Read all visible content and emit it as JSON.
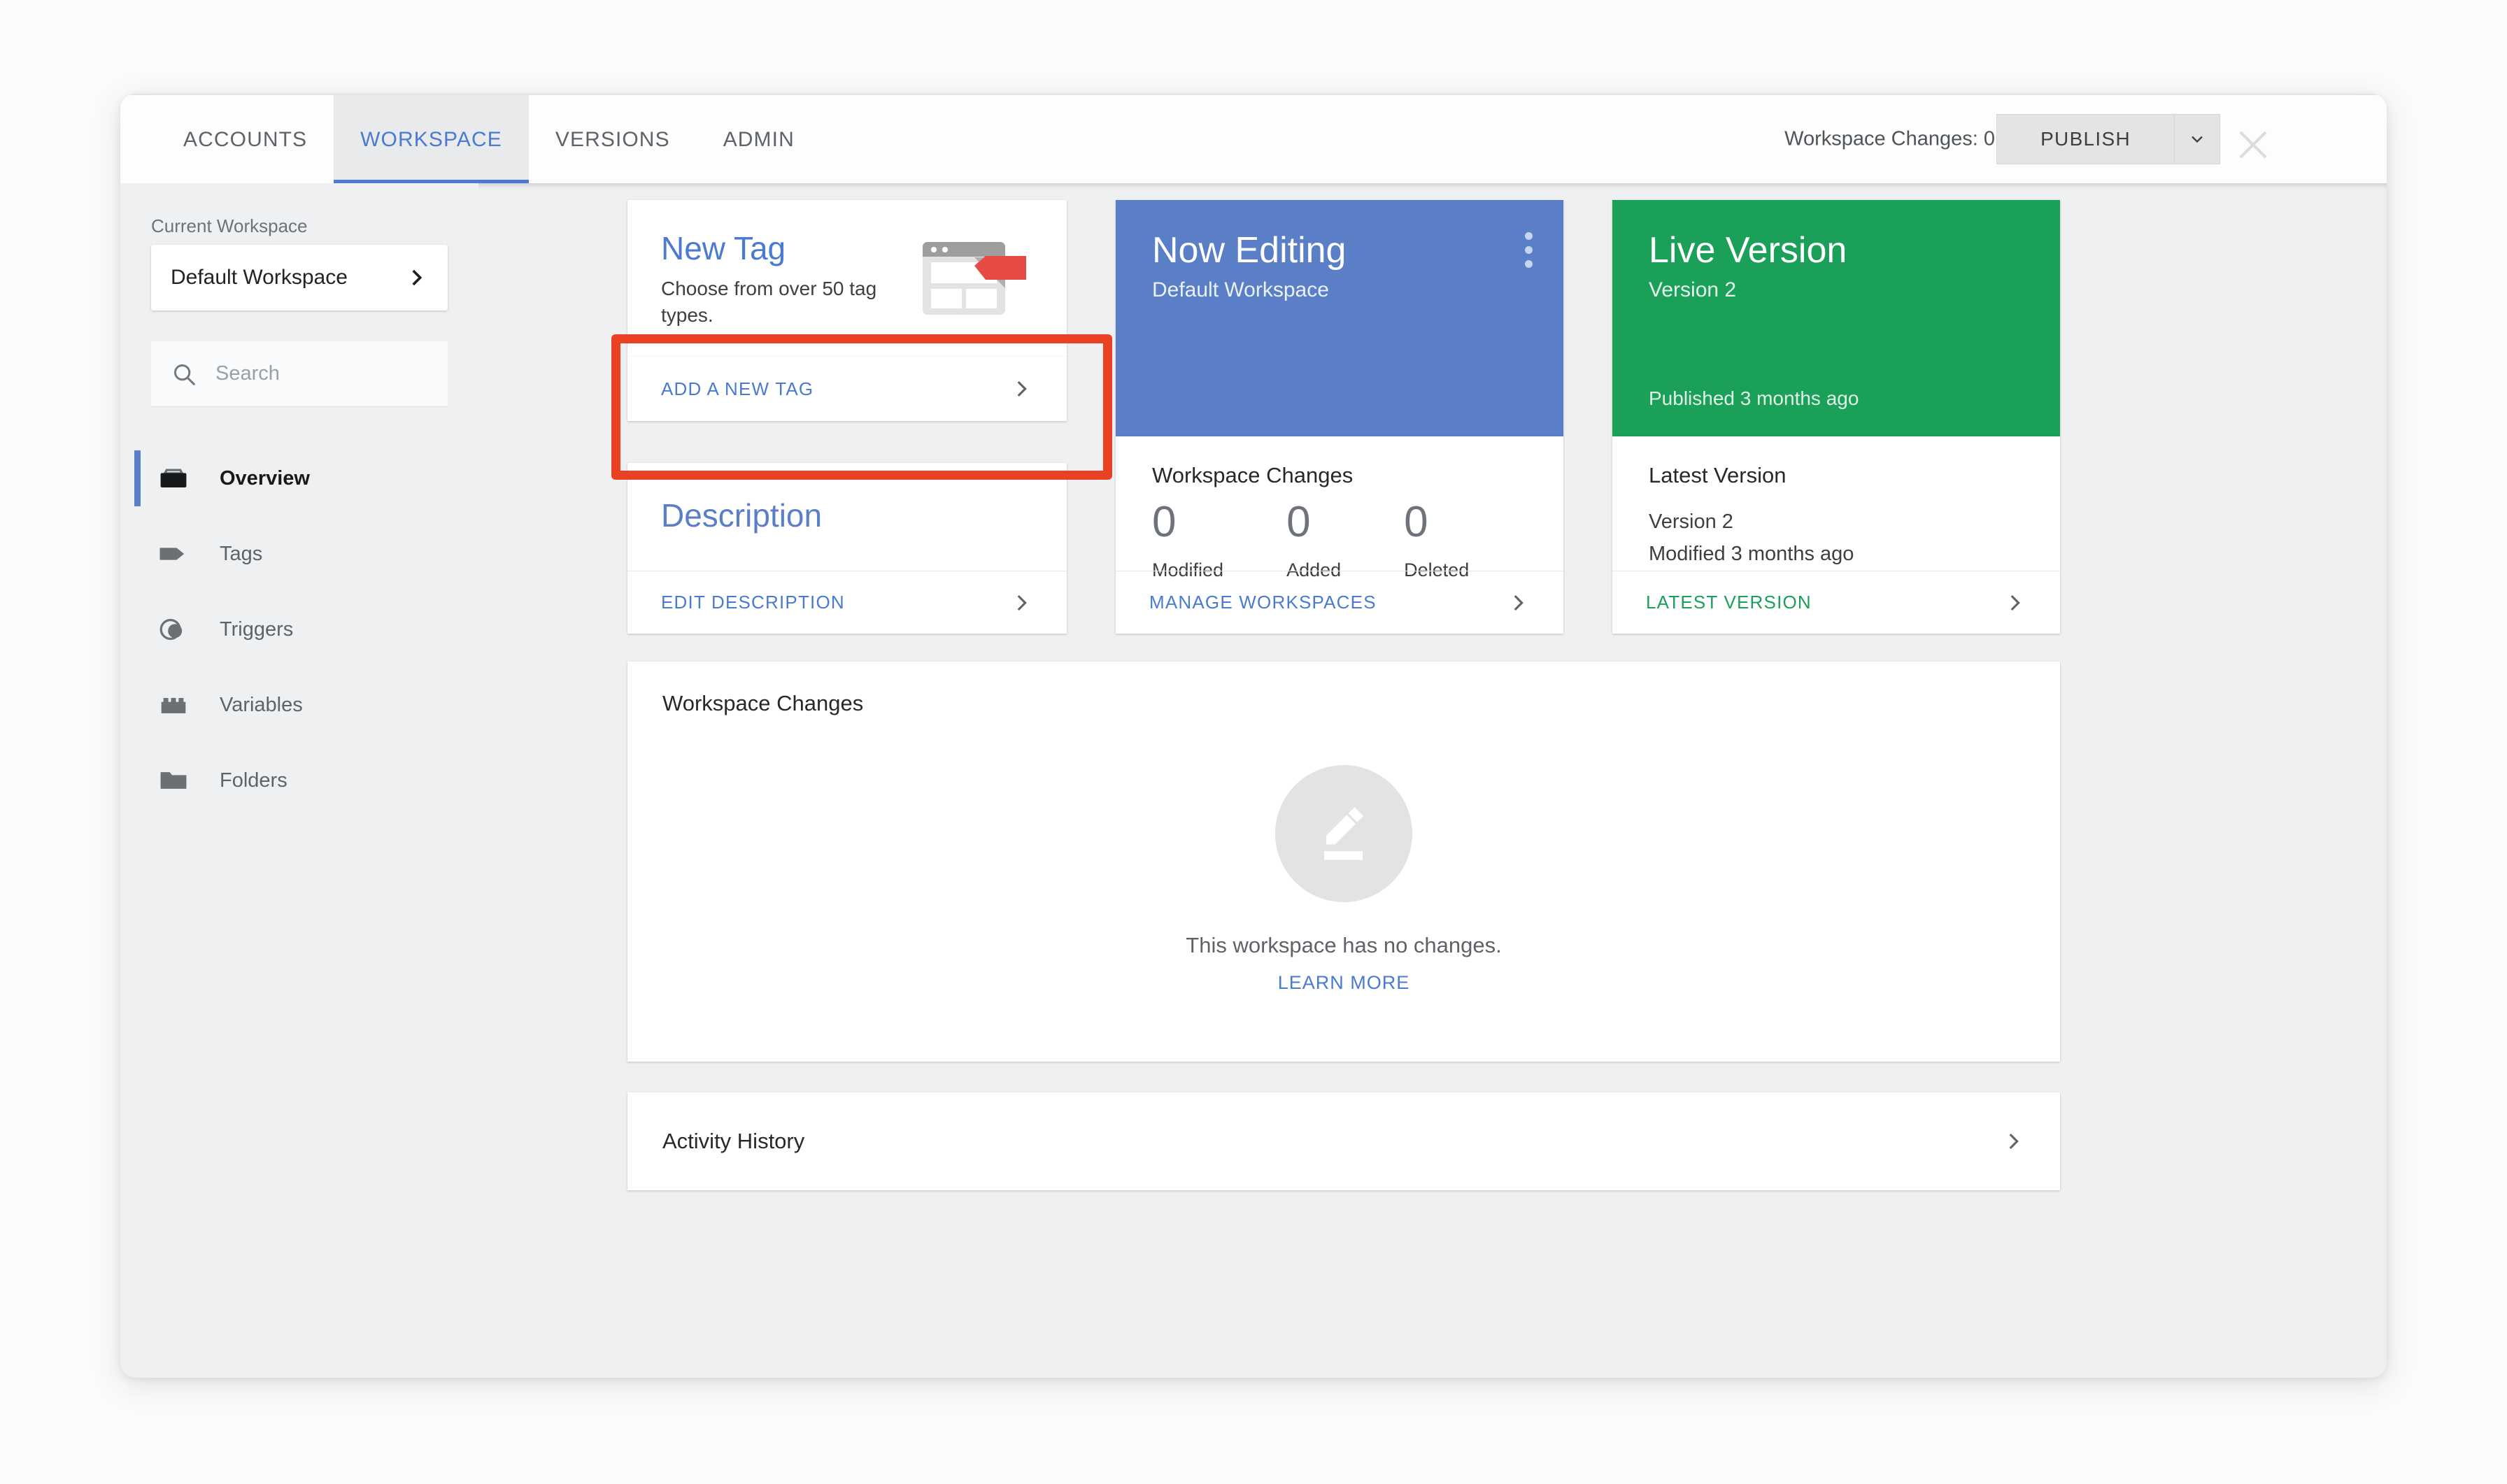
{
  "topbar": {
    "tabs": [
      {
        "label": "ACCOUNTS",
        "active": false
      },
      {
        "label": "WORKSPACE",
        "active": true
      },
      {
        "label": "VERSIONS",
        "active": false
      },
      {
        "label": "ADMIN",
        "active": false
      }
    ],
    "workspace_changes_status": "Workspace Changes: 0",
    "publish_label": "PUBLISH",
    "publish_caret_icon": "chevron-down-icon",
    "close_icon": "close-icon"
  },
  "sidebar": {
    "current_workspace_label": "Current Workspace",
    "workspace_name": "Default Workspace",
    "workspace_chevron_icon": "chevron-right-icon",
    "search": {
      "placeholder": "Search",
      "value": "",
      "icon": "search-icon"
    },
    "items": [
      {
        "label": "Overview",
        "icon": "toolbox-icon",
        "active": true
      },
      {
        "label": "Tags",
        "icon": "tag-icon",
        "active": false
      },
      {
        "label": "Triggers",
        "icon": "triggers-icon",
        "active": false
      },
      {
        "label": "Variables",
        "icon": "brick-icon",
        "active": false
      },
      {
        "label": "Folders",
        "icon": "folder-icon",
        "active": false
      }
    ]
  },
  "cards": {
    "new_tag": {
      "title": "New Tag",
      "subtitle": "Choose from over 50 tag types.",
      "illustration_icon": "browser-window-tag-illustration",
      "action_label": "ADD A NEW TAG",
      "action_chevron_icon": "chevron-right-icon",
      "highlighted": true
    },
    "description": {
      "title": "Description",
      "action_label": "EDIT DESCRIPTION",
      "action_chevron_icon": "chevron-right-icon"
    },
    "now_editing": {
      "title": "Now Editing",
      "subtitle": "Default Workspace",
      "menu_icon": "more-vert-icon",
      "changes_heading": "Workspace Changes",
      "counts": [
        {
          "value": "0",
          "label": "Modified"
        },
        {
          "value": "0",
          "label": "Added"
        },
        {
          "value": "0",
          "label": "Deleted"
        }
      ],
      "action_label": "MANAGE WORKSPACES",
      "action_chevron_icon": "chevron-right-icon"
    },
    "live_version": {
      "title": "Live Version",
      "subtitle": "Version 2",
      "published": "Published 3 months ago",
      "latest_heading": "Latest Version",
      "latest_version": "Version 2",
      "latest_modified": "Modified 3 months ago",
      "action_label": "LATEST VERSION",
      "action_chevron_icon": "chevron-right-icon"
    }
  },
  "panels": {
    "workspace_changes": {
      "title": "Workspace Changes",
      "empty_icon": "pencil-edit-icon",
      "empty_message": "This workspace has no changes.",
      "learn_more_label": "LEARN MORE"
    },
    "activity_history": {
      "title": "Activity History",
      "chevron_icon": "chevron-right-icon"
    }
  },
  "colors": {
    "accent_blue": "#4a7ad1",
    "card_blue": "#5b7fc7",
    "card_green": "#1ba05a",
    "annotation_red": "#ea4124",
    "page_bg": "#eef0f1"
  }
}
